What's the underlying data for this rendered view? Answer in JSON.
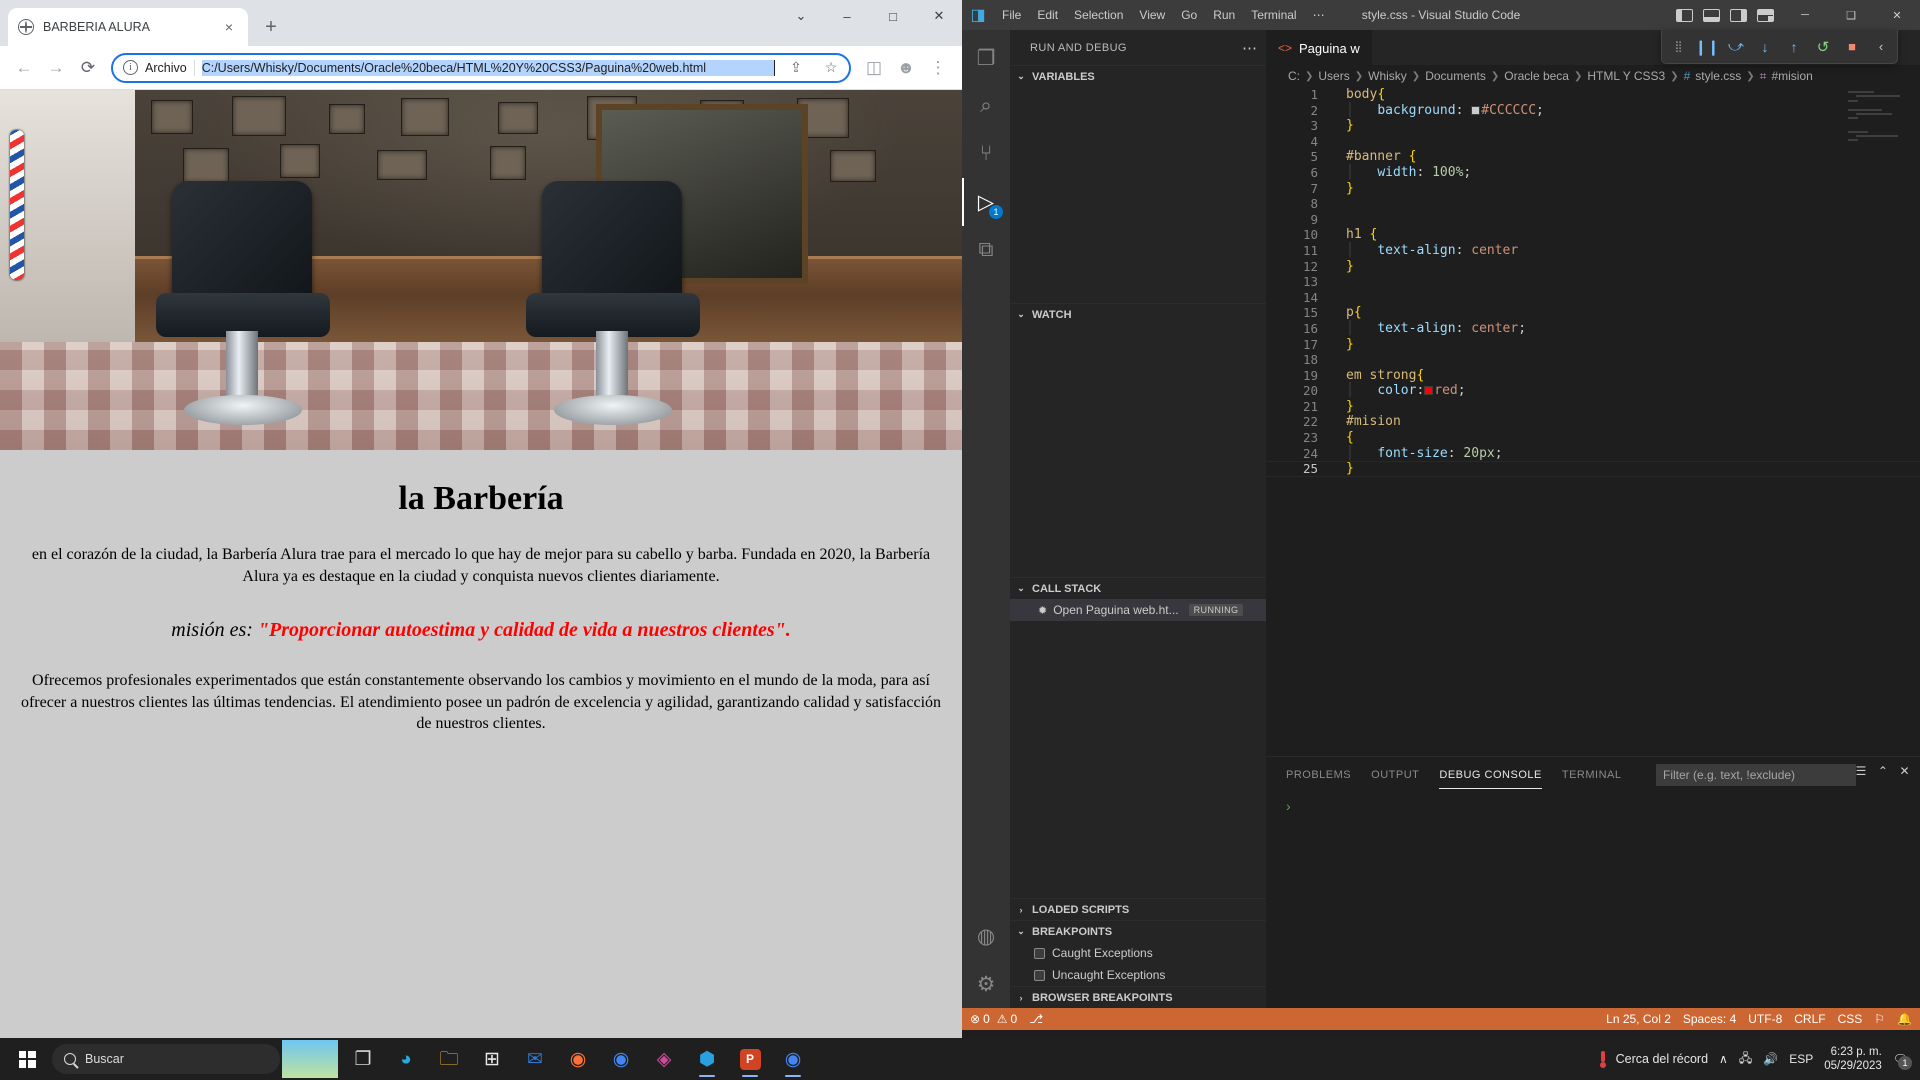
{
  "browser": {
    "tab": {
      "title": "BARBERIA ALURA",
      "favicon": "globe-icon",
      "close": "×"
    },
    "new_tab": "+",
    "window_controls": {
      "menu": "⌄",
      "minimize": "–",
      "maximize": "□",
      "close": "✕"
    },
    "toolbar": {
      "back": "←",
      "forward": "→",
      "reload": "⟳",
      "info_icon": "ⓘ",
      "scheme_label": "Archivo",
      "url": "C:/Users/Whisky/Documents/Oracle%20beca/HTML%20Y%20CSS3/Paguina%20web.html",
      "share": "share-icon",
      "bookmark": "☆",
      "sidepanel": "◫",
      "profile": "profile-icon",
      "menu": "⋮"
    },
    "page": {
      "banner_alt": "barberia-interior-banner",
      "h1": "la Barbería",
      "paragraph1": "en el corazón de la ciudad, la Barbería Alura trae para el mercado lo que hay de mejor para su cabello y barba. Fundada en 2020, la Barbería Alura ya es destaque en la ciudad y conquista nuevos clientes diariamente.",
      "mision_prefix": "misión es: ",
      "mision_quote": "\"Proporcionar autoestima y calidad de vida a nuestros clientes\".",
      "paragraph3": "Ofrecemos profesionales experimentados que están constantemente observando los cambios y movimiento en el mundo de la moda, para así ofrecer a nuestros clientes las últimas tendencias. El atendimiento posee un padrón de excelencia y agilidad, garantizando calidad y satisfacción de nuestros clientes."
    }
  },
  "vscode": {
    "title": "style.css - Visual Studio Code",
    "logo": "vscode-logo-icon",
    "menu": [
      "File",
      "Edit",
      "Selection",
      "View",
      "Go",
      "Run",
      "Terminal",
      "⋯"
    ],
    "layout_icons": [
      "toggle-primary-sidebar-icon",
      "toggle-panel-icon",
      "toggle-secondary-sidebar-icon",
      "customize-layout-icon"
    ],
    "window_controls": {
      "minimize": "─",
      "maximize": "❑",
      "close": "✕"
    },
    "activitybar": [
      {
        "name": "explorer",
        "glyph": "❐",
        "active": false
      },
      {
        "name": "search",
        "glyph": "⚲",
        "active": false
      },
      {
        "name": "source-control",
        "glyph": "⑂",
        "active": false
      },
      {
        "name": "run-and-debug",
        "glyph": "▷",
        "active": true,
        "badge": "1"
      },
      {
        "name": "extensions",
        "glyph": "⧉",
        "active": false
      },
      {
        "name": "accounts",
        "glyph": "◑",
        "active": false
      },
      {
        "name": "manage-settings",
        "glyph": "⚙",
        "active": false
      }
    ],
    "sidebar": {
      "header": "RUN AND DEBUG",
      "more": "⋯",
      "panes": [
        {
          "name": "variables",
          "label": "VARIABLES",
          "expanded": true
        },
        {
          "name": "watch",
          "label": "WATCH",
          "expanded": true
        },
        {
          "name": "call-stack",
          "label": "CALL STACK",
          "expanded": true
        },
        {
          "name": "loaded-scripts",
          "label": "LOADED SCRIPTS",
          "expanded": false
        },
        {
          "name": "breakpoints",
          "label": "BREAKPOINTS",
          "expanded": true
        },
        {
          "name": "browser-breakpoints",
          "label": "BROWSER BREAKPOINTS",
          "expanded": false
        }
      ],
      "call_stack": {
        "session": "Open Paguina web.ht...",
        "status": "RUNNING",
        "icon": "bug-icon"
      },
      "breakpoints": [
        {
          "label": "Caught Exceptions",
          "checked": false
        },
        {
          "label": "Uncaught Exceptions",
          "checked": false
        }
      ]
    },
    "editor": {
      "tab": {
        "label": "Paguina w",
        "icon": "html-file-icon"
      },
      "debug_toolbar": [
        {
          "name": "drag-handle",
          "glyph": "⠇"
        },
        {
          "name": "pause-button",
          "glyph": "❘❘",
          "color": "#75beff"
        },
        {
          "name": "step-over-button",
          "glyph": "↷",
          "color": "#75beff"
        },
        {
          "name": "step-into-button",
          "glyph": "↓",
          "color": "#75beff"
        },
        {
          "name": "step-out-button",
          "glyph": "↑",
          "color": "#75beff"
        },
        {
          "name": "restart-button",
          "glyph": "↺",
          "color": "#89d185"
        },
        {
          "name": "stop-button",
          "glyph": "□",
          "color": "#f48771"
        },
        {
          "name": "collapse-button",
          "glyph": "‹",
          "color": "#cccccc"
        }
      ],
      "breadcrumbs": [
        "C:",
        "Users",
        "Whisky",
        "Documents",
        "Oracle beca",
        "HTML Y CSS3",
        "style.css",
        "#mision"
      ],
      "code_lines": [
        {
          "n": 1,
          "text": "body{"
        },
        {
          "n": 2,
          "text": "    background:  #CCCCCC;"
        },
        {
          "n": 3,
          "text": "}"
        },
        {
          "n": 4,
          "text": ""
        },
        {
          "n": 5,
          "text": "#banner {"
        },
        {
          "n": 6,
          "text": "    width: 100%;"
        },
        {
          "n": 7,
          "text": "}"
        },
        {
          "n": 8,
          "text": ""
        },
        {
          "n": 9,
          "text": ""
        },
        {
          "n": 10,
          "text": "h1 {"
        },
        {
          "n": 11,
          "text": "    text-align: center"
        },
        {
          "n": 12,
          "text": "}"
        },
        {
          "n": 13,
          "text": ""
        },
        {
          "n": 14,
          "text": ""
        },
        {
          "n": 15,
          "text": "p{"
        },
        {
          "n": 16,
          "text": "    text-align: center;"
        },
        {
          "n": 17,
          "text": "}"
        },
        {
          "n": 18,
          "text": ""
        },
        {
          "n": 19,
          "text": "em strong{"
        },
        {
          "n": 20,
          "text": "    color: red;"
        },
        {
          "n": 21,
          "text": "}"
        },
        {
          "n": 22,
          "text": "#mision"
        },
        {
          "n": 23,
          "text": "{"
        },
        {
          "n": 24,
          "text": "    font-size: 20px;"
        },
        {
          "n": 25,
          "text": "}"
        }
      ],
      "swatch_background": "#CCCCCC",
      "swatch_color": "#FF0000"
    },
    "panel": {
      "tabs": [
        {
          "label": "PROBLEMS",
          "active": false
        },
        {
          "label": "OUTPUT",
          "active": false
        },
        {
          "label": "DEBUG CONSOLE",
          "active": true
        },
        {
          "label": "TERMINAL",
          "active": false
        }
      ],
      "filter_placeholder": "Filter (e.g. text, !exclude)",
      "actions": [
        "clear-console-icon",
        "chevron-up-icon",
        "close-panel-icon"
      ],
      "prompt": "›"
    },
    "statusbar": {
      "errors": "0",
      "warnings": "0",
      "debug_icon": "debug-status-icon",
      "position": "Ln 25, Col 2",
      "spaces": "Spaces: 4",
      "encoding": "UTF-8",
      "eol": "CRLF",
      "language": "CSS",
      "feedback": "☂",
      "bell": "⚇"
    }
  },
  "taskbar": {
    "start": "windows-logo",
    "search_placeholder": "Buscar",
    "weather_tile": "weather-widget",
    "apps": [
      {
        "name": "task-view",
        "glyph": "⧉",
        "color": "#d6d6d6",
        "running": false
      },
      {
        "name": "edge",
        "glyph": "◔",
        "color": "#2aa9e0",
        "running": false
      },
      {
        "name": "file-explorer",
        "glyph": "☐",
        "color": "#f2b134",
        "running": false
      },
      {
        "name": "microsoft-store",
        "glyph": "⊞",
        "color": "#e8e8e8",
        "running": false
      },
      {
        "name": "mail",
        "glyph": "✉",
        "color": "#2f7ad4",
        "running": false
      },
      {
        "name": "firefox",
        "glyph": "●",
        "color": "#ff7139",
        "running": false
      },
      {
        "name": "chrome",
        "glyph": "●",
        "color": "#4285f4",
        "running": false
      },
      {
        "name": "photos",
        "glyph": "◈",
        "color": "#cf4b9a",
        "running": false
      },
      {
        "name": "vscode",
        "glyph": "⬢",
        "color": "#2aa0e0",
        "running": true
      },
      {
        "name": "powerpoint",
        "glyph": "P",
        "color": "#d04423",
        "running": true
      },
      {
        "name": "google-chrome-active",
        "glyph": "●",
        "color": "#4285f4",
        "running": true
      }
    ],
    "tray": {
      "weather_text": "Cerca del récord",
      "weather_icon": "thermometer-icon",
      "overflow": "∧",
      "network": "network-icon",
      "volume": "volume-icon",
      "language": "ESP",
      "time": "6:23 p. m.",
      "date": "05/29/2023",
      "notifications": "notifications-icon",
      "notification_count": "1"
    }
  }
}
